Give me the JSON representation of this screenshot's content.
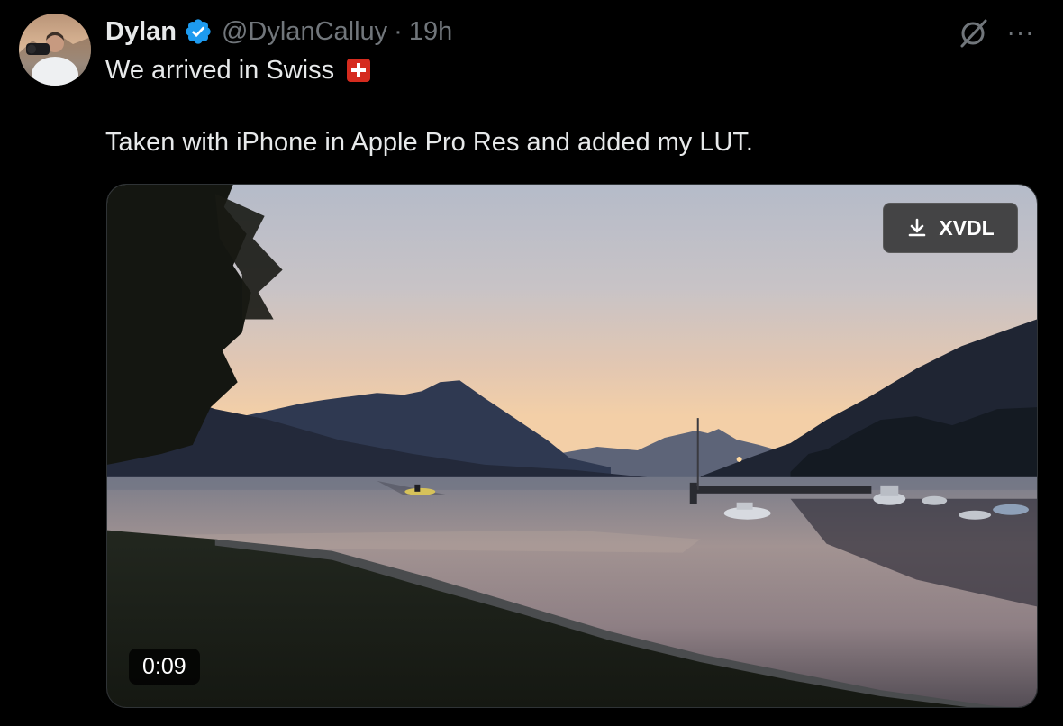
{
  "author": {
    "name": "Dylan",
    "handle": "@DylanCalluy",
    "separator": "·",
    "time": "19h",
    "avatar_icon": "profile-photo",
    "verified_icon": "verified-badge-icon",
    "verified_color": "#1d9bf0"
  },
  "tweet": {
    "line1": "We arrived in Swiss",
    "flag_icon": "swiss-flag-icon",
    "line2": "Taken with iPhone in Apple Pro Res and added my LUT."
  },
  "actions": {
    "grok_icon": "grok-icon",
    "more_label": "···"
  },
  "media": {
    "download_label": "XVDL",
    "download_icon": "download-icon",
    "duration": "0:09"
  },
  "colors": {
    "background": "#000000",
    "text_primary": "#e7e9ea",
    "text_secondary": "#71767b"
  }
}
